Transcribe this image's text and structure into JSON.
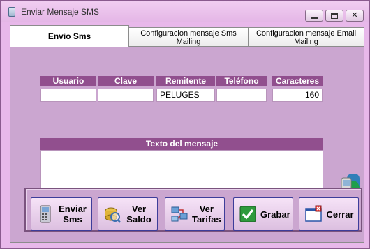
{
  "window": {
    "title": "Enviar Mensaje SMS"
  },
  "tabs": [
    {
      "label": "Envio Sms"
    },
    {
      "label": "Configuracion mensaje Sms Mailing"
    },
    {
      "label": "Configuracion mensaje Email Mailing"
    }
  ],
  "fields": {
    "usuario": {
      "header": "Usuario",
      "value": ""
    },
    "clave": {
      "header": "Clave",
      "value": ""
    },
    "remitente": {
      "header": "Remitente",
      "value": "PELUGES"
    },
    "telefono": {
      "header": "Teléfono",
      "value": ""
    },
    "caracteres": {
      "header": "Caracteres",
      "value": "160"
    }
  },
  "message": {
    "header": "Texto del mensaje",
    "value": ""
  },
  "buttons": {
    "enviar_l1": "Enviar",
    "enviar_l2": "Sms",
    "saldo_l1": "Ver",
    "saldo_l2": "Saldo",
    "tarifas_l1": "Ver",
    "tarifas_l2": "Tarifas",
    "grabar": "Grabar",
    "cerrar": "Cerrar"
  },
  "colors": {
    "header_bg": "#914f8e",
    "panel_bg": "#cba6d0",
    "window_bg": "#e8b8ea",
    "button_border": "#3d3d9a"
  },
  "icons": [
    "phone-icon",
    "sms-icon",
    "coins-icon",
    "tariff-icon",
    "check-icon",
    "close-window-icon"
  ]
}
